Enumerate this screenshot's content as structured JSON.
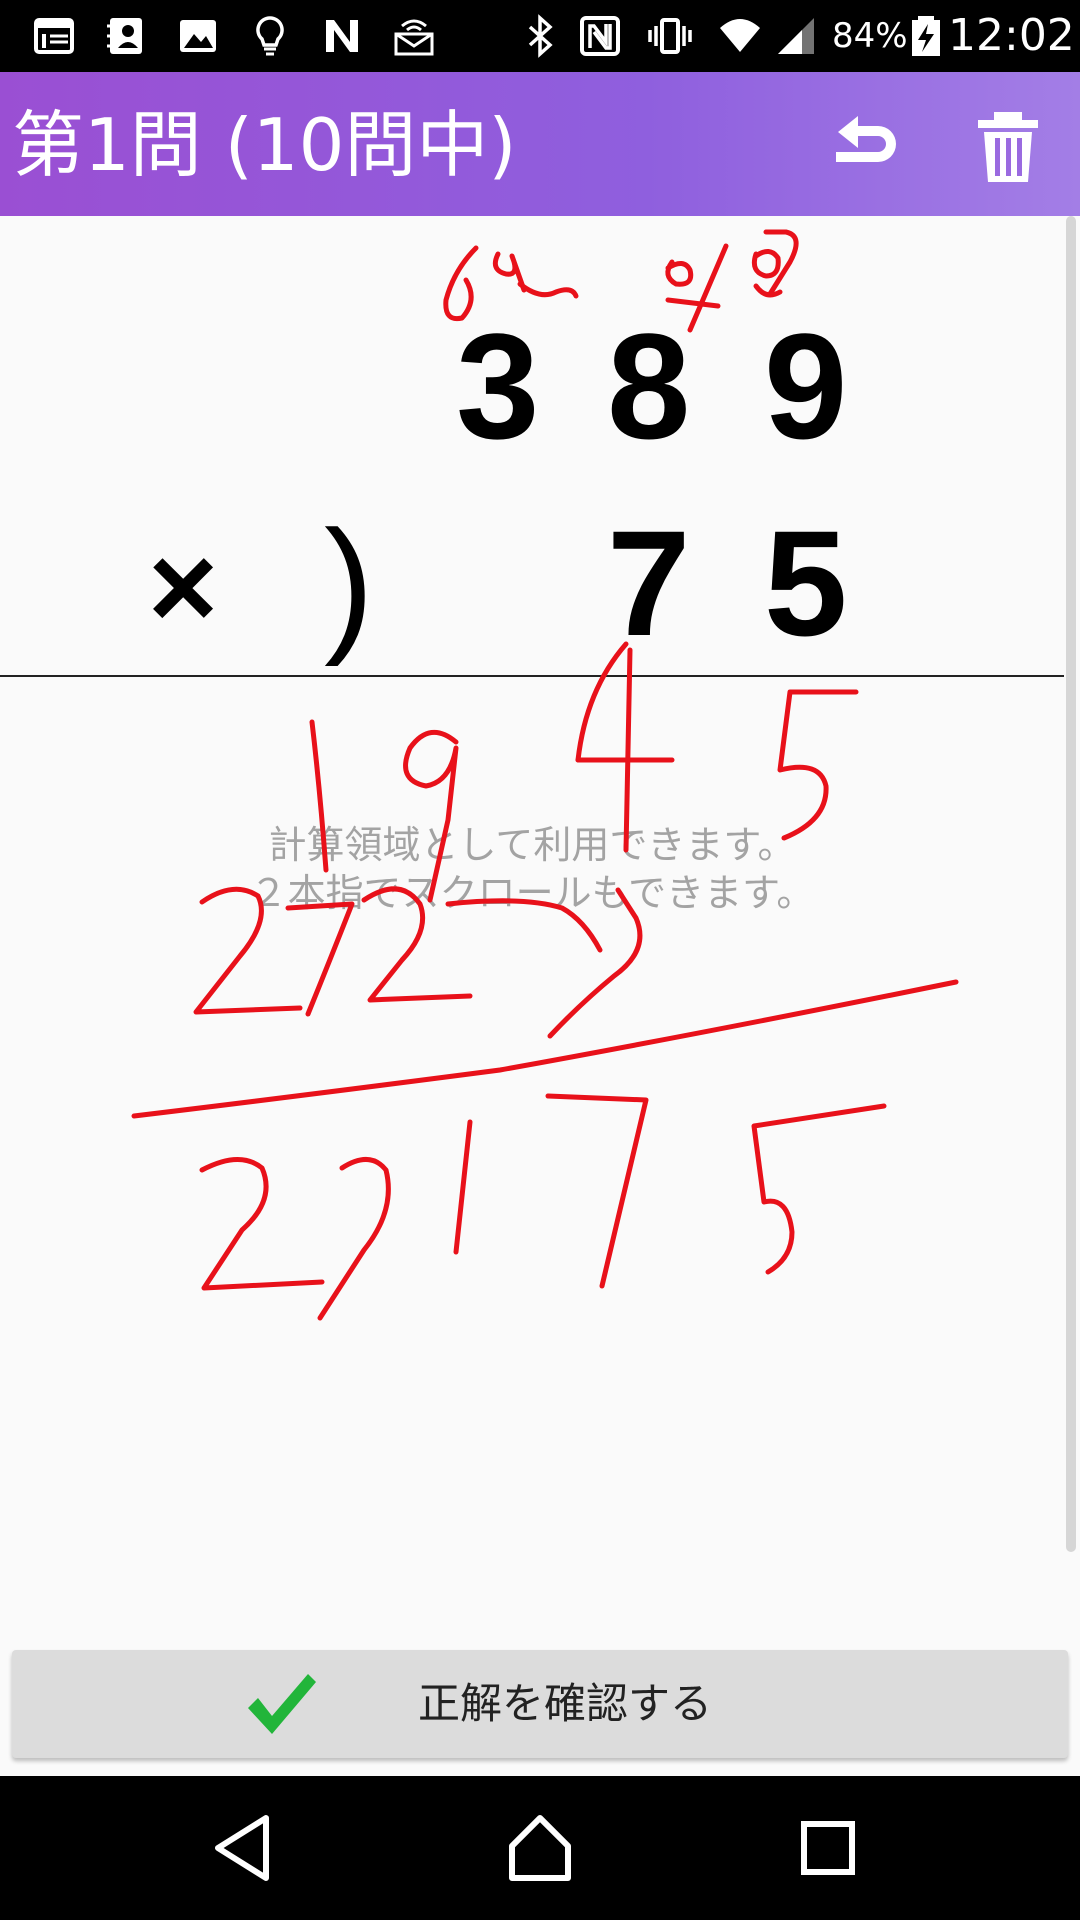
{
  "status_bar": {
    "battery": "84%",
    "time": "12:02"
  },
  "app_bar": {
    "title": "第1問 (10問中)",
    "undo_icon": "undo-icon",
    "trash_icon": "trash-icon"
  },
  "problem": {
    "multiplicand": [
      "3",
      "8",
      "9"
    ],
    "operator": "×",
    "bracket": ")",
    "multiplier": [
      "7",
      "5"
    ]
  },
  "canvas": {
    "hint_line1": "計算領域として利用できます。",
    "hint_line2": "２本指でスクロールもできます。",
    "ink_color": "#e8111a"
  },
  "actions": {
    "check_label": "正解を確認する",
    "check_icon": "checkmark-icon",
    "check_color": "#22b53a"
  },
  "nav": {
    "back": "back-icon",
    "home": "home-icon",
    "recents": "recents-icon"
  }
}
